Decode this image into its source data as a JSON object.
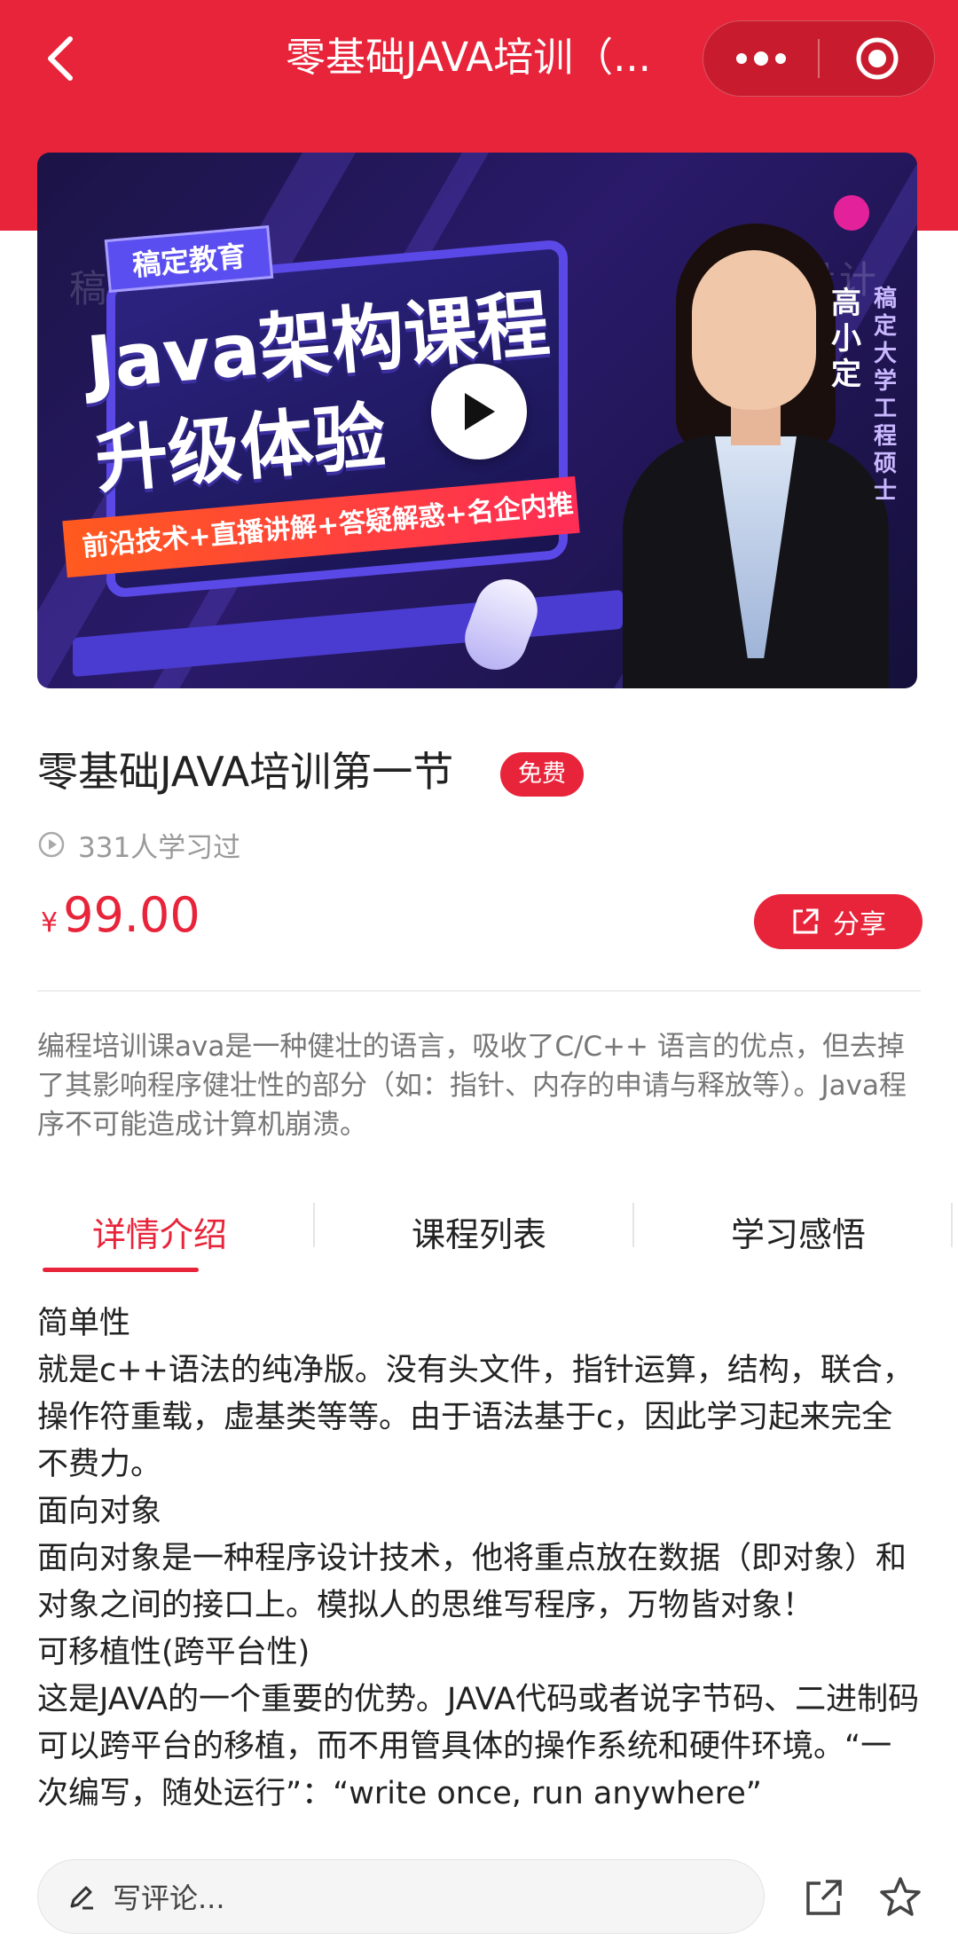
{
  "header": {
    "back_icon": "chevron-left-icon",
    "title": "零基础JAVA培训（...",
    "more_icon": "more-dots-icon",
    "record_icon": "target-circle-icon",
    "color": "#e8243a"
  },
  "banner": {
    "brand_tag": "稿定教育",
    "hero_line1": "Java架构课程",
    "hero_line2": "升级体验",
    "features": "前沿技术+直播讲解+答疑解惑+名企内推",
    "watermark_left": "稿定设计",
    "watermark_right": "稿定设计",
    "teacher_name": "高小定",
    "teacher_title": "稿定大学工程硕士",
    "play_icon": "play-icon"
  },
  "course": {
    "title": "零基础JAVA培训第一节",
    "badge": "免费",
    "learners": "331人学习过",
    "currency": "¥",
    "price": "99.00",
    "share_label": "分享",
    "summary": "编程培训课ava是一种健壮的语言，吸收了C/C++ 语言的优点，但去掉了其影响程序健壮性的部分（如：指针、内存的申请与释放等）。Java程序不可能造成计算机崩溃。"
  },
  "tabs": [
    {
      "label": "详情介绍",
      "active": true
    },
    {
      "label": "课程列表",
      "active": false
    },
    {
      "label": "学习感悟",
      "active": false
    }
  ],
  "detail": {
    "h1": "简单性",
    "p1": "就是c++语法的纯净版。没有头文件，指针运算，结构，联合，操作符重载，虚基类等等。由于语法基于c，因此学习起来完全不费力。",
    "h2": "面向对象",
    "p2": "面向对象是一种程序设计技术，他将重点放在数据（即对象）和对象之间的接口上。模拟人的思维写程序，万物皆对象！",
    "h3": "可移植性(跨平台性)",
    "p3": "这是JAVA的一个重要的优势。JAVA代码或者说字节码、二进制码可以跨平台的移植，而不用管具体的操作系统和硬件环境。“一次编写，随处运行”：“write once, run anywhere”"
  },
  "bottom": {
    "comment_placeholder": "写评论...",
    "edit_icon": "pencil-icon",
    "share_icon": "share-icon",
    "favorite_icon": "star-icon"
  }
}
